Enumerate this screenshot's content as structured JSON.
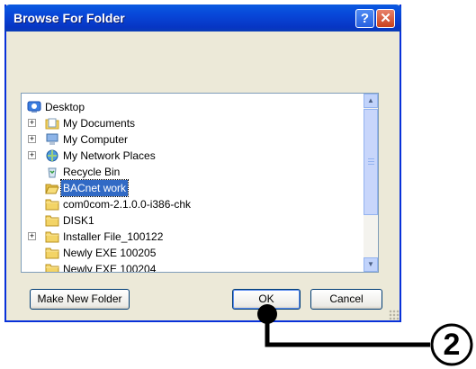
{
  "window": {
    "title": "Browse For Folder",
    "help_label": "?",
    "close_label": "✕"
  },
  "tree": {
    "items": [
      {
        "label": "Desktop",
        "icon": "desktop-icon",
        "expander": "",
        "selected": false
      },
      {
        "label": "My Documents",
        "icon": "my-documents-icon",
        "expander": "+",
        "selected": false
      },
      {
        "label": "My Computer",
        "icon": "my-computer-icon",
        "expander": "+",
        "selected": false
      },
      {
        "label": "My Network Places",
        "icon": "network-places-icon",
        "expander": "+",
        "selected": false
      },
      {
        "label": "Recycle Bin",
        "icon": "recycle-bin-icon",
        "expander": "",
        "selected": false
      },
      {
        "label": "BACnet work",
        "icon": "folder-open-icon",
        "expander": "",
        "selected": true
      },
      {
        "label": "com0com-2.1.0.0-i386-chk",
        "icon": "folder-icon",
        "expander": "",
        "selected": false
      },
      {
        "label": "DISK1",
        "icon": "folder-icon",
        "expander": "",
        "selected": false
      },
      {
        "label": "Installer File_100122",
        "icon": "folder-icon",
        "expander": "+",
        "selected": false
      },
      {
        "label": "Newly EXE 100205",
        "icon": "folder-icon",
        "expander": "",
        "selected": false
      },
      {
        "label": "Newly EXE 100204",
        "icon": "folder-icon",
        "expander": "",
        "selected": false
      }
    ]
  },
  "buttons": {
    "new_folder": "Make New Folder",
    "ok": "OK",
    "cancel": "Cancel"
  },
  "callout": {
    "number": "2"
  },
  "colors": {
    "selection": "#316ac5",
    "titlebar": "#0846d8",
    "dialog_bg": "#ece9d8"
  }
}
